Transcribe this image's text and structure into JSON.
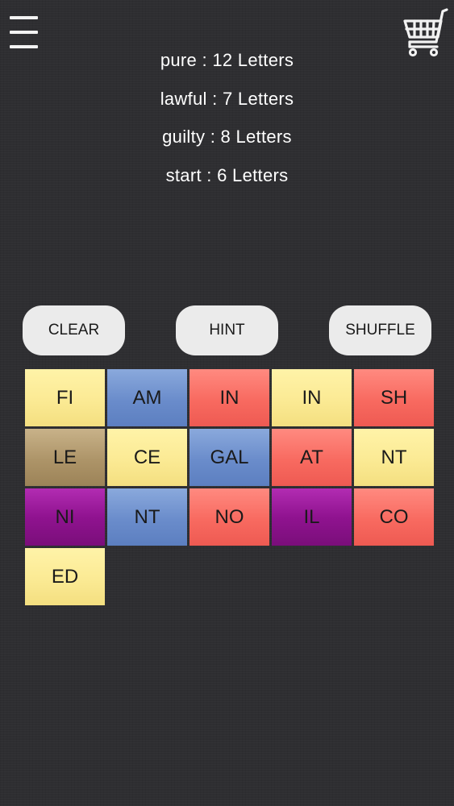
{
  "header": {
    "menu_icon": "hamburger-menu-icon",
    "cart_icon": "shopping-cart-icon"
  },
  "clues": [
    {
      "text": "pure : 12 Letters"
    },
    {
      "text": "lawful : 7 Letters"
    },
    {
      "text": "guilty : 8 Letters"
    },
    {
      "text": "start : 6 Letters"
    }
  ],
  "buttons": {
    "clear": "CLEAR",
    "hint": "HINT",
    "shuffle": "SHUFFLE"
  },
  "colors": {
    "yellow": "#fbea94",
    "blue": "#6a8ccb",
    "red": "#f86a60",
    "brown": "#ad9468",
    "purple": "#901390",
    "background": "#2e2e31",
    "button": "#ebebeb"
  },
  "tiles": [
    {
      "label": "FI",
      "color": "yellow"
    },
    {
      "label": "AM",
      "color": "blue"
    },
    {
      "label": "IN",
      "color": "red"
    },
    {
      "label": "IN",
      "color": "yellow"
    },
    {
      "label": "SH",
      "color": "red"
    },
    {
      "label": "LE",
      "color": "brown"
    },
    {
      "label": "CE",
      "color": "yellow"
    },
    {
      "label": "GAL",
      "color": "blue"
    },
    {
      "label": "AT",
      "color": "red"
    },
    {
      "label": "NT",
      "color": "yellow"
    },
    {
      "label": "NI",
      "color": "purple"
    },
    {
      "label": "NT",
      "color": "blue"
    },
    {
      "label": "NO",
      "color": "red"
    },
    {
      "label": "IL",
      "color": "purple"
    },
    {
      "label": "CO",
      "color": "red"
    },
    {
      "label": "ED",
      "color": "yellow"
    }
  ]
}
